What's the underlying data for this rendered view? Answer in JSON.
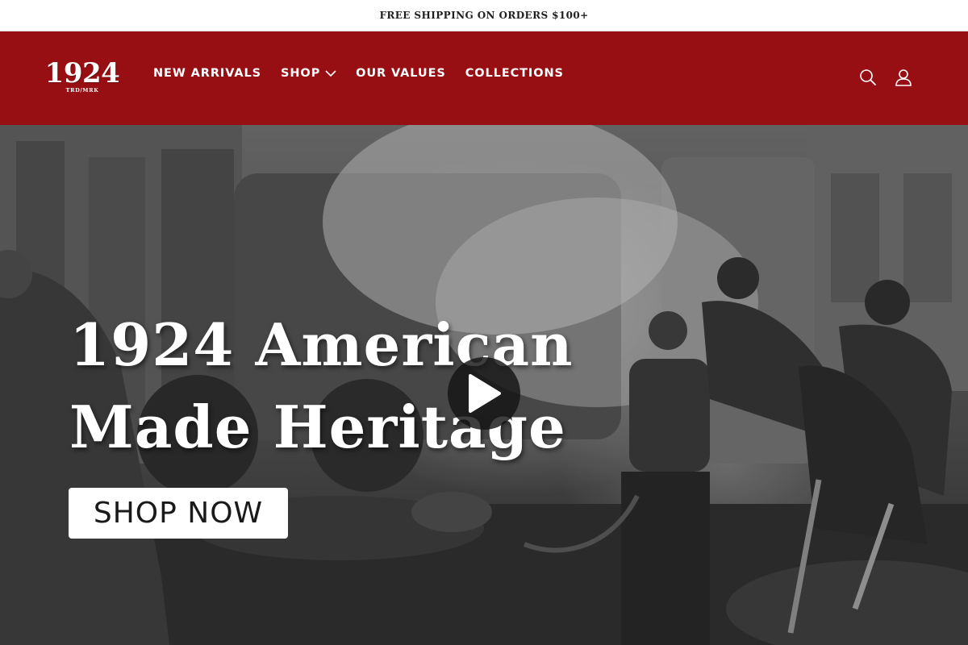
{
  "announcement": {
    "text": "FREE SHIPPING ON ORDERS $100+"
  },
  "header": {
    "logo": {
      "number": "1924",
      "subtext": "TRD/MRK"
    },
    "nav": [
      {
        "label": "NEW ARRIVALS"
      },
      {
        "label": "SHOP",
        "has_dropdown": true
      },
      {
        "label": "OUR VALUES"
      },
      {
        "label": "COLLECTIONS"
      }
    ],
    "icons": [
      "search-icon",
      "account-icon"
    ]
  },
  "hero": {
    "title_line1": "1924 American",
    "title_line2": "Made Heritage",
    "cta_label": "SHOP NOW",
    "play_icon": "play-icon"
  },
  "colors": {
    "header_bg": "#970f13",
    "announcement_bg": "#ffffff",
    "cta_bg": "#ffffff",
    "text_light": "#ffffff"
  }
}
